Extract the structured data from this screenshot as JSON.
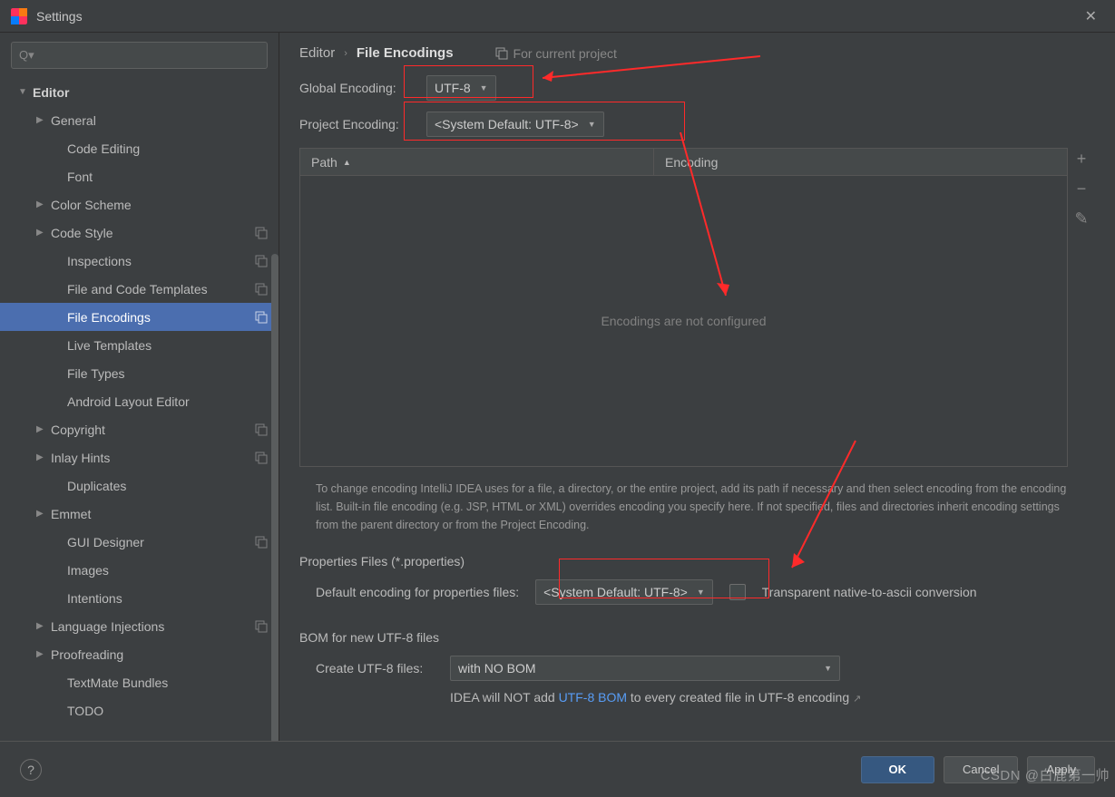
{
  "title": "Settings",
  "search_placeholder": "",
  "tree": {
    "editor": "Editor",
    "general": "General",
    "code_editing": "Code Editing",
    "font": "Font",
    "color_scheme": "Color Scheme",
    "code_style": "Code Style",
    "inspections": "Inspections",
    "file_code_templates": "File and Code Templates",
    "file_encodings": "File Encodings",
    "live_templates": "Live Templates",
    "file_types": "File Types",
    "android_layout_editor": "Android Layout Editor",
    "copyright": "Copyright",
    "inlay_hints": "Inlay Hints",
    "duplicates": "Duplicates",
    "emmet": "Emmet",
    "gui_designer": "GUI Designer",
    "images": "Images",
    "intentions": "Intentions",
    "language_injections": "Language Injections",
    "proofreading": "Proofreading",
    "textmate_bundles": "TextMate Bundles",
    "todo": "TODO"
  },
  "breadcrumb": {
    "editor": "Editor",
    "current": "File Encodings",
    "scope": "For current project"
  },
  "global_encoding": {
    "label": "Global Encoding:",
    "value": "UTF-8"
  },
  "project_encoding": {
    "label": "Project Encoding:",
    "value": "<System Default: UTF-8>"
  },
  "table": {
    "col_path": "Path",
    "col_encoding": "Encoding",
    "empty": "Encodings are not configured"
  },
  "help_text": "To change encoding IntelliJ IDEA uses for a file, a directory, or the entire project, add its path if necessary and then select encoding from the encoding list. Built-in file encoding (e.g. JSP, HTML or XML) overrides encoding you specify here. If not specified, files and directories inherit encoding settings from the parent directory or from the Project Encoding.",
  "properties": {
    "title": "Properties Files (*.properties)",
    "label": "Default encoding for properties files:",
    "value": "<System Default: UTF-8>",
    "checkbox_label": "Transparent native-to-ascii conversion"
  },
  "bom": {
    "title": "BOM for new UTF-8 files",
    "label": "Create UTF-8 files:",
    "value": "with NO BOM",
    "note_pre": "IDEA will NOT add ",
    "note_link": "UTF-8 BOM",
    "note_post": " to every created file in UTF-8 encoding"
  },
  "buttons": {
    "ok": "OK",
    "cancel": "Cancel",
    "apply": "Apply"
  },
  "watermark": "CSDN @白鹿第一帅"
}
